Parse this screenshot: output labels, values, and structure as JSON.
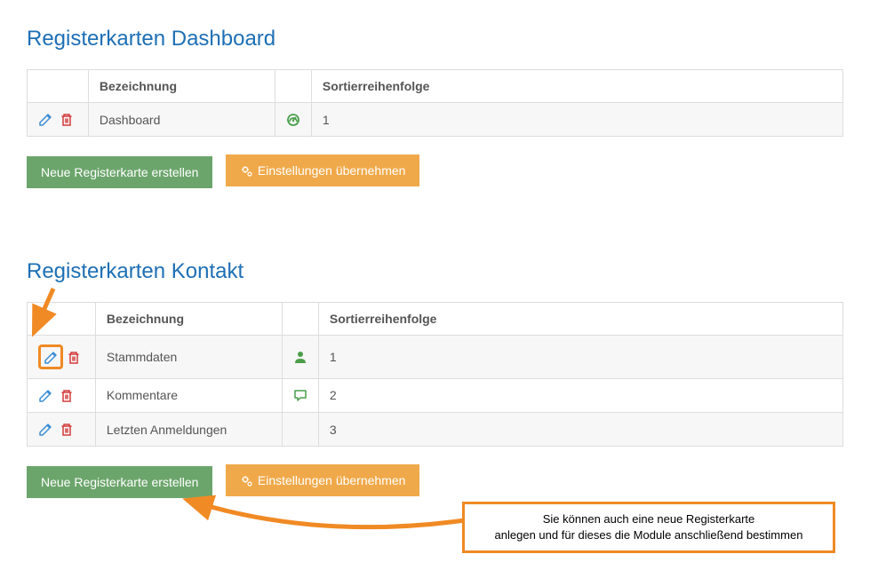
{
  "section1": {
    "title": "Registerkarten Dashboard",
    "headers": {
      "name": "Bezeichnung",
      "sort": "Sortierreihenfolge"
    },
    "rows": [
      {
        "name": "Dashboard",
        "icon": "dashboard",
        "sort": "1"
      }
    ],
    "btn_create": "Neue Registerkarte erstellen",
    "btn_apply": "Einstellungen übernehmen"
  },
  "section2": {
    "title": "Registerkarten Kontakt",
    "headers": {
      "name": "Bezeichnung",
      "sort": "Sortierreihenfolge"
    },
    "rows": [
      {
        "name": "Stammdaten",
        "icon": "user",
        "sort": "1"
      },
      {
        "name": "Kommentare",
        "icon": "comment",
        "sort": "2"
      },
      {
        "name": "Letzten Anmeldungen",
        "icon": "",
        "sort": "3"
      }
    ],
    "btn_create": "Neue Registerkarte erstellen",
    "btn_apply": "Einstellungen übernehmen"
  },
  "callout": {
    "line1": "Sie können auch eine neue Registerkarte",
    "line2": "anlegen und für dieses die Module anschließend bestimmen"
  }
}
